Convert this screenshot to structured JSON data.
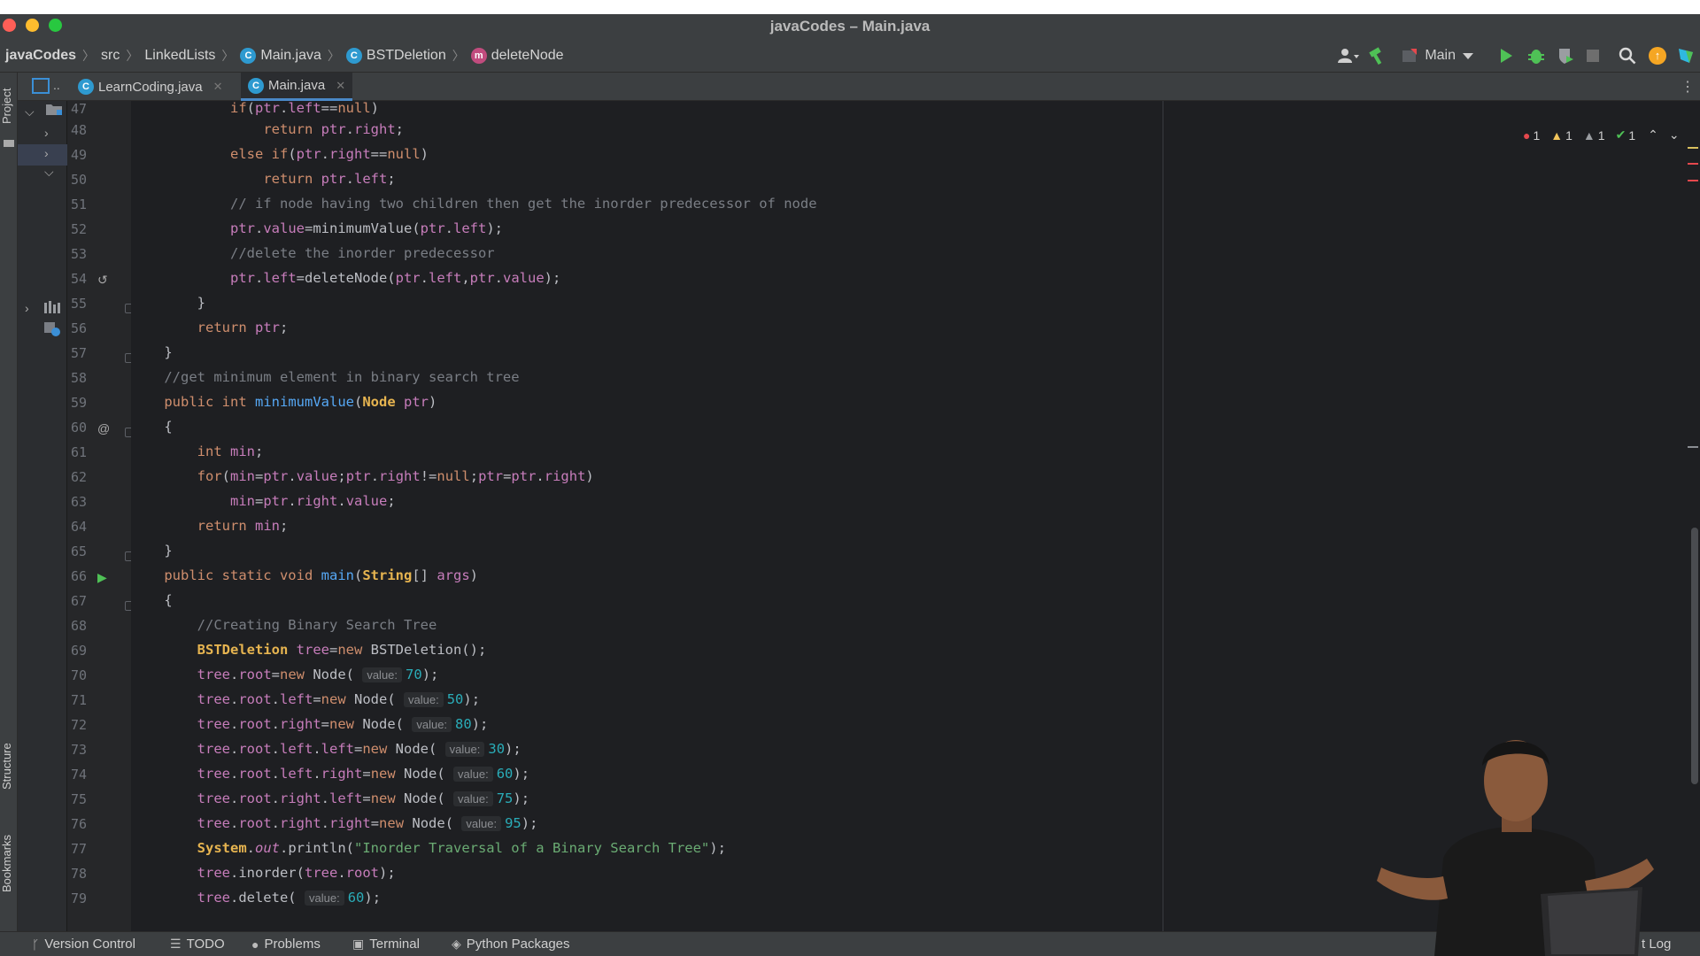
{
  "window": {
    "title": "javaCodes – Main.java"
  },
  "breadcrumbs": [
    {
      "label": "javaCodes",
      "icon": ""
    },
    {
      "label": "src",
      "icon": ""
    },
    {
      "label": "LinkedLists",
      "icon": ""
    },
    {
      "label": "Main.java",
      "icon": "class-icon"
    },
    {
      "label": "BSTDeletion",
      "icon": "class-icon"
    },
    {
      "label": "deleteNode",
      "icon": "method-icon"
    }
  ],
  "toolbar": {
    "run_config": "Main"
  },
  "tabs": [
    {
      "label": "LearnCoding.java",
      "active": false
    },
    {
      "label": "Main.java",
      "active": true
    }
  ],
  "tool_strip": {
    "project": "Project",
    "structure": "Structure",
    "bookmarks": "Bookmarks"
  },
  "inspections": {
    "errors": "1",
    "warnings": "1",
    "weak_warnings": "1",
    "ok": "1"
  },
  "editor": {
    "line_numbers": [
      "47",
      "48",
      "49",
      "50",
      "51",
      "52",
      "53",
      "54",
      "55",
      "56",
      "57",
      "58",
      "59",
      "60",
      "61",
      "62",
      "63",
      "64",
      "65",
      "66",
      "67",
      "68",
      "69",
      "70",
      "71",
      "72",
      "73",
      "74",
      "75",
      "76",
      "77",
      "78",
      "79"
    ],
    "inlay_hint": "value:"
  },
  "status_bar": {
    "version_control": "Version Control",
    "todo": "TODO",
    "problems": "Problems",
    "terminal": "Terminal",
    "python_packages": "Python Packages",
    "event_log": "t Log"
  },
  "colors": {
    "accent": "#4a88c7",
    "run_green": "#4fc156",
    "error_red": "#e5484d",
    "warning_yellow": "#f2c55c"
  }
}
